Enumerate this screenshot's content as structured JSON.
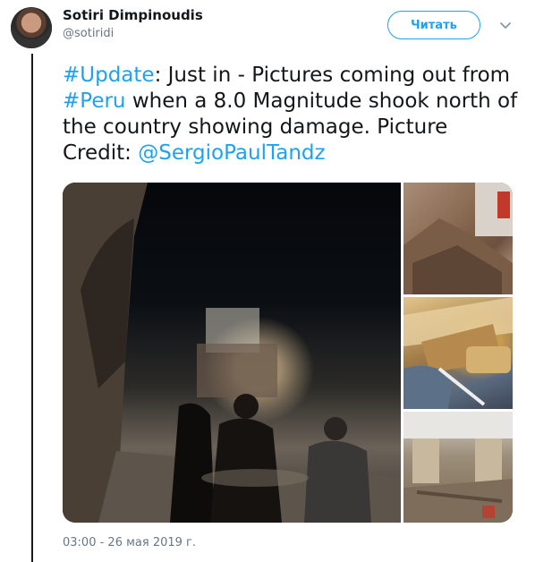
{
  "author": {
    "name": "Sotiri Dimpinoudis",
    "handle": "@sotiridi"
  },
  "actions": {
    "follow_label": "Читать",
    "menu_icon": "chevron-down-icon"
  },
  "tweet": {
    "segments": [
      {
        "text": "#Update",
        "link": true
      },
      {
        "text": ": Just in - Pictures coming out from ",
        "link": false
      },
      {
        "text": "#Peru",
        "link": true
      },
      {
        "text": " when a 8.0 Magnitude shook north of the country showing damage. Picture Credit: ",
        "link": false
      },
      {
        "text": "@SergioPaulTandz",
        "link": true
      }
    ],
    "timestamp": "03:00 - 26 мая 2019 г."
  },
  "colors": {
    "link": "#1da1f2",
    "text": "#14171a",
    "muted": "#657786",
    "thread_line": "#1b1b1b"
  }
}
